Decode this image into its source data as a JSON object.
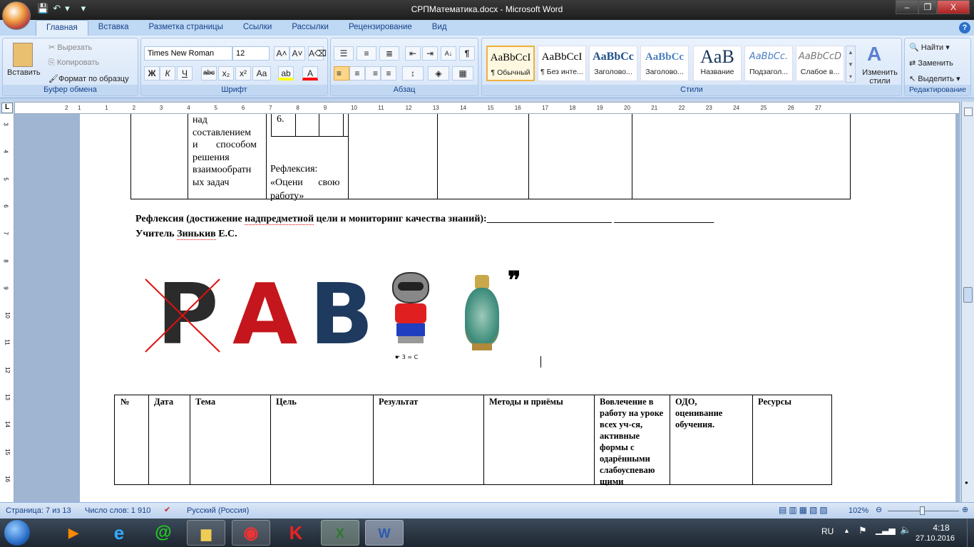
{
  "window": {
    "title": "СРПМатематика.docx - Microsoft Word",
    "minimize": "–",
    "restore": "❐",
    "close": "X"
  },
  "qat": {
    "save": "💾",
    "undo": "↶",
    "undo_drop": "▾",
    "customize": "▾"
  },
  "tabs": [
    "Главная",
    "Вставка",
    "Разметка страницы",
    "Ссылки",
    "Рассылки",
    "Рецензирование",
    "Вид"
  ],
  "help": "?",
  "clipboard": {
    "paste": "Вставить",
    "cut": "Вырезать",
    "copy": "Копировать",
    "format_painter": "Формат по образцу",
    "label": "Буфер обмена"
  },
  "font": {
    "name": "Times New Roman",
    "size": "12",
    "grow": "A˄",
    "shrink": "A˅",
    "clear": "A⌫",
    "bold": "Ж",
    "italic": "К",
    "underline": "Ч",
    "strike": "abc",
    "sub": "x₂",
    "sup": "x²",
    "case": "Aa",
    "highlight": "ab",
    "color": "A",
    "label": "Шрифт",
    "highlight_color": "#ffff00",
    "font_color": "#ff0000"
  },
  "paragraph": {
    "label": "Абзац",
    "bullets": "☰",
    "numbering": "≡",
    "multilevel": "≣",
    "dec_indent": "⇤",
    "inc_indent": "⇥",
    "sort": "А↓",
    "pilcrow": "¶",
    "left": "≡",
    "center": "≡",
    "right": "≡",
    "justify": "≡",
    "spacing": "↕",
    "shading": "◈",
    "borders": "▦"
  },
  "styles": {
    "label": "Стили",
    "change": "Изменить стили",
    "items": [
      {
        "preview": "AaBbCcI",
        "name": "¶ Обычный"
      },
      {
        "preview": "AaBbCcI",
        "name": "¶ Без инте..."
      },
      {
        "preview": "AaBbCc",
        "name": "Заголово..."
      },
      {
        "preview": "AaBbCc",
        "name": "Заголово..."
      },
      {
        "preview": "AaB",
        "name": "Название"
      },
      {
        "preview": "AaBbCc.",
        "name": "Подзагол..."
      },
      {
        "preview": "AaBbCcD",
        "name": "Слабое в..."
      }
    ]
  },
  "editing": {
    "find": "Найти",
    "replace": "Заменить",
    "select": "Выделить",
    "label": "Редактирование"
  },
  "ruler": {
    "tab_selector": "L",
    "ticks": [
      "2",
      "1",
      "1",
      "2",
      "3",
      "4",
      "5",
      "6",
      "7",
      "8",
      "9",
      "10",
      "11",
      "12",
      "13",
      "14",
      "15",
      "16",
      "17",
      "18",
      "19",
      "20",
      "21",
      "22",
      "23",
      "24",
      "25",
      "26",
      "27"
    ],
    "vticks": [
      "3",
      "4",
      "5",
      "6",
      "7",
      "8",
      "9",
      "10",
      "11",
      "12",
      "13",
      "14",
      "15",
      "16"
    ]
  },
  "document": {
    "top_table": {
      "col2": [
        "над",
        "составлением",
        "и способом",
        "решения",
        "взаимообратн",
        "ых задач"
      ],
      "inner_cell": "6.",
      "col3": [
        "Рефлексия:",
        "«Оцени свою",
        "работу»"
      ]
    },
    "reflection_line": "Рефлексия (достижение надпредметной цели и мониторинг качества знаний):_________________________ ____________________",
    "reflection_word_underlined": "надпредметной",
    "teacher_prefix": "Учитель",
    "teacher_name": "Зинькив",
    "teacher_initials": "Е.С.",
    "rebus": {
      "letters": [
        "Р",
        "А",
        "В"
      ],
      "crossed_letter": "Р",
      "note": "3 = С",
      "quote": "❞",
      "raccoon": "raccoon-image",
      "vase": "vase-image"
    },
    "bottom_table": {
      "headers": [
        "№",
        "Дата",
        "Тема",
        "Цель",
        "Результат",
        "Методы и приёмы",
        "Вовлечение в работу на уроке всех уч-ся, активные формы с одарёнными слабоуспеваю щими",
        "ОДО, оценивание обучения.",
        "Ресурсы"
      ]
    }
  },
  "status": {
    "page": "Страница: 7 из 13",
    "words": "Число слов: 1 910",
    "language": "Русский (Россия)",
    "zoom": "102%",
    "zoom_level": 102
  },
  "taskbar": {
    "lang": "RU",
    "time": "4:18",
    "date": "27.10.2016",
    "apps": [
      "media-player",
      "internet-explorer",
      "mail-agent",
      "file-explorer",
      "chrome",
      "kaspersky",
      "excel",
      "word"
    ]
  }
}
